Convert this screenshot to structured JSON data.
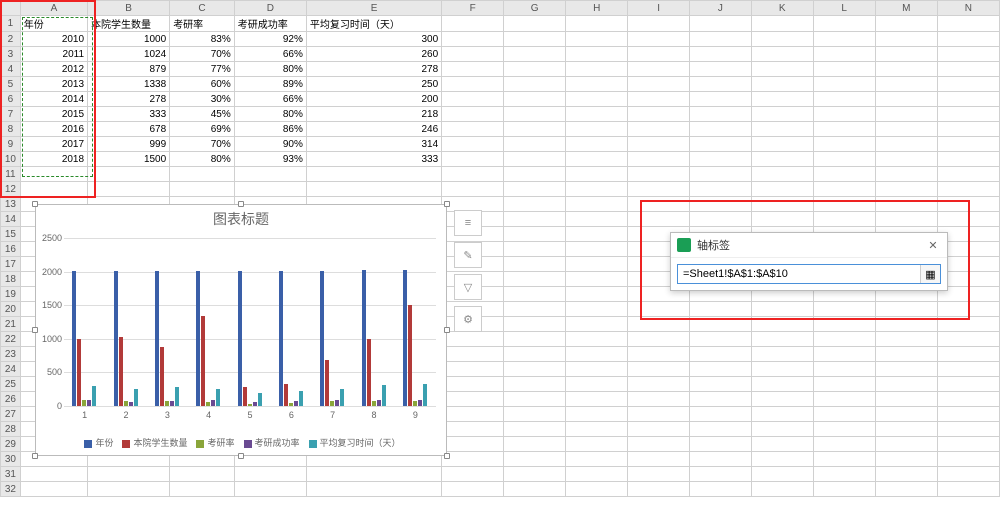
{
  "columns": [
    "A",
    "B",
    "C",
    "D",
    "E",
    "F",
    "G",
    "H",
    "I",
    "J",
    "K",
    "L",
    "M",
    "N"
  ],
  "headers": {
    "A": "年份",
    "B": "本院学生数量",
    "C": "考研率",
    "D": "考研成功率",
    "E": "平均复习时间（天）"
  },
  "rows": [
    {
      "A": "2010",
      "B": "1000",
      "C": "83%",
      "D": "92%",
      "E": "300"
    },
    {
      "A": "2011",
      "B": "1024",
      "C": "70%",
      "D": "66%",
      "E": "260"
    },
    {
      "A": "2012",
      "B": "879",
      "C": "77%",
      "D": "80%",
      "E": "278"
    },
    {
      "A": "2013",
      "B": "1338",
      "C": "60%",
      "D": "89%",
      "E": "250"
    },
    {
      "A": "2014",
      "B": "278",
      "C": "30%",
      "D": "66%",
      "E": "200"
    },
    {
      "A": "2015",
      "B": "333",
      "C": "45%",
      "D": "80%",
      "E": "218"
    },
    {
      "A": "2016",
      "B": "678",
      "C": "69%",
      "D": "86%",
      "E": "246"
    },
    {
      "A": "2017",
      "B": "999",
      "C": "70%",
      "D": "90%",
      "E": "314"
    },
    {
      "A": "2018",
      "B": "1500",
      "C": "80%",
      "D": "93%",
      "E": "333"
    }
  ],
  "total_rows": 32,
  "chart_data": {
    "type": "bar",
    "title": "图表标题",
    "categories": [
      "1",
      "2",
      "3",
      "4",
      "5",
      "6",
      "7",
      "8",
      "9"
    ],
    "series": [
      {
        "name": "年份",
        "values": [
          2010,
          2011,
          2012,
          2013,
          2014,
          2015,
          2016,
          2017,
          2018
        ],
        "color": "#3a5fa8"
      },
      {
        "name": "本院学生数量",
        "values": [
          1000,
          1024,
          879,
          1338,
          278,
          333,
          678,
          999,
          1500
        ],
        "color": "#b23a39"
      },
      {
        "name": "考研率",
        "values": [
          83,
          70,
          77,
          60,
          30,
          45,
          69,
          70,
          80
        ],
        "color": "#8aa53a"
      },
      {
        "name": "考研成功率",
        "values": [
          92,
          66,
          80,
          89,
          66,
          80,
          86,
          90,
          93
        ],
        "color": "#6a4a92"
      },
      {
        "name": "平均复习时间（天）",
        "values": [
          300,
          260,
          278,
          250,
          200,
          218,
          246,
          314,
          333
        ],
        "color": "#3aa0b0"
      }
    ],
    "ylim": [
      0,
      2500
    ],
    "yticks": [
      0,
      500,
      1000,
      1500,
      2000,
      2500
    ]
  },
  "side_tools": [
    "chart-settings-icon",
    "brush-icon",
    "filter-icon",
    "gear-icon"
  ],
  "side_glyphs": [
    "≡",
    "✎",
    "▽",
    "⚙"
  ],
  "dialog": {
    "title": "轴标签",
    "value": "=Sheet1!$A$1:$A$10",
    "close": "✕"
  }
}
